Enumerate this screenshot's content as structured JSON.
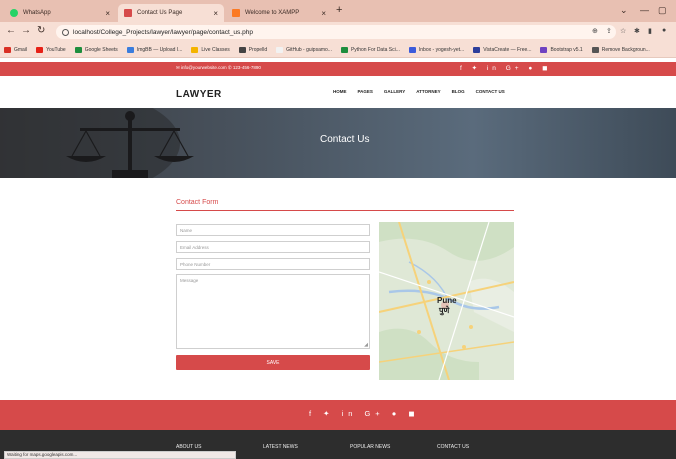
{
  "browser": {
    "tabs": [
      {
        "title": "WhatsApp",
        "active": false
      },
      {
        "title": "Contact Us Page",
        "active": true
      },
      {
        "title": "Welcome to XAMPP",
        "active": false
      }
    ],
    "new_tab": "+",
    "url": "localhost/College_Projects/lawyer/lawyer/page/contact_us.php",
    "bookmarks": [
      {
        "label": "Gmail",
        "color": "#d93025"
      },
      {
        "label": "YouTube",
        "color": "#e62117"
      },
      {
        "label": "Google Sheets",
        "color": "#1e8e3e"
      },
      {
        "label": "ImgBB — Upload I...",
        "color": "#3b7ddd"
      },
      {
        "label": "Live Classes",
        "color": "#f4b400"
      },
      {
        "label": "Propelld",
        "color": "#444444"
      },
      {
        "label": "GitHub - guipsamo...",
        "color": "#f2f2f2"
      },
      {
        "label": "Python For Data Sci...",
        "color": "#1e8e3e"
      },
      {
        "label": "Inbox - yogesh-yet...",
        "color": "#3b5bdb"
      },
      {
        "label": "VistaCreate — Free...",
        "color": "#2c3e9b"
      },
      {
        "label": "Bootstrap v5.1",
        "color": "#6f42c1"
      },
      {
        "label": "Remove Backgroun...",
        "color": "#555555"
      }
    ],
    "status_text": "Waiting for maps.googleapis.com..."
  },
  "site": {
    "topbar": {
      "contact": "✉ info@yourwebsite.com   ✆ 123-456-7890",
      "social": "f  ✦  in  G+  ●  ◼"
    },
    "logo": "LAWYER",
    "nav": [
      "HOME",
      "PAGES",
      "GALLERY",
      "ATTORNEY",
      "BLOG",
      "CONTACT US"
    ],
    "hero_title": "Contact Us",
    "form": {
      "title": "Contact Form",
      "name_placeholder": "Name",
      "email_placeholder": "Email Address",
      "phone_placeholder": "Phone Number",
      "message_placeholder": "Message",
      "save_label": "SAVE"
    },
    "map": {
      "city_label": "Pune",
      "city_label_local": "पुणे"
    },
    "footer": {
      "social": "f  ✦  in  G+  ●  ◼",
      "columns": [
        "ABOUT US",
        "LATEST NEWS",
        "POPULAR NEWS",
        "CONTACT US"
      ]
    }
  },
  "colors": {
    "brand_red": "#d64a4a",
    "browser_tab_bg": "#e8c0b2",
    "footer_dark": "#2d2d2d"
  }
}
